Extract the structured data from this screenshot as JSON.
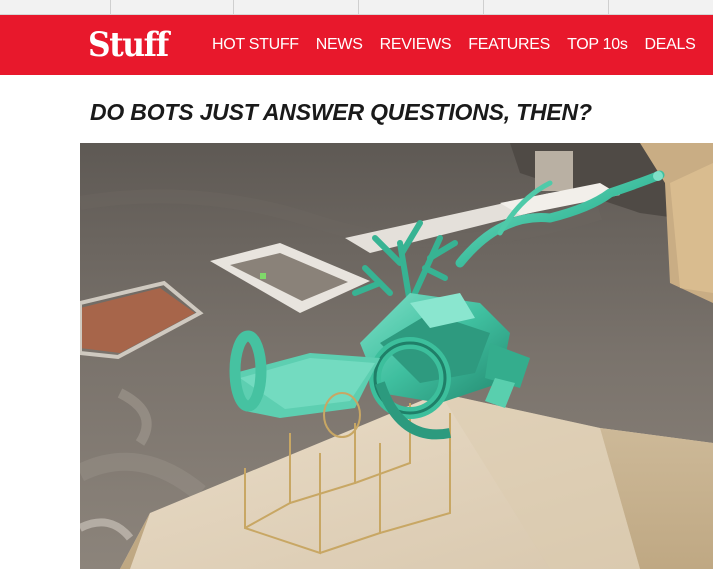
{
  "header": {
    "logo_text": "Stuff",
    "brand_color": "#e8182c",
    "nav_items": [
      {
        "label": "HOT STUFF"
      },
      {
        "label": "NEWS"
      },
      {
        "label": "REVIEWS"
      },
      {
        "label": "FEATURES"
      },
      {
        "label": "TOP 10s"
      },
      {
        "label": "DEALS"
      }
    ]
  },
  "article": {
    "headline": "DO BOTS JUST ANSWER QUESTIONS, THEN?"
  },
  "photo": {
    "subject": "green-sculpture-on-wooden-plinth"
  }
}
